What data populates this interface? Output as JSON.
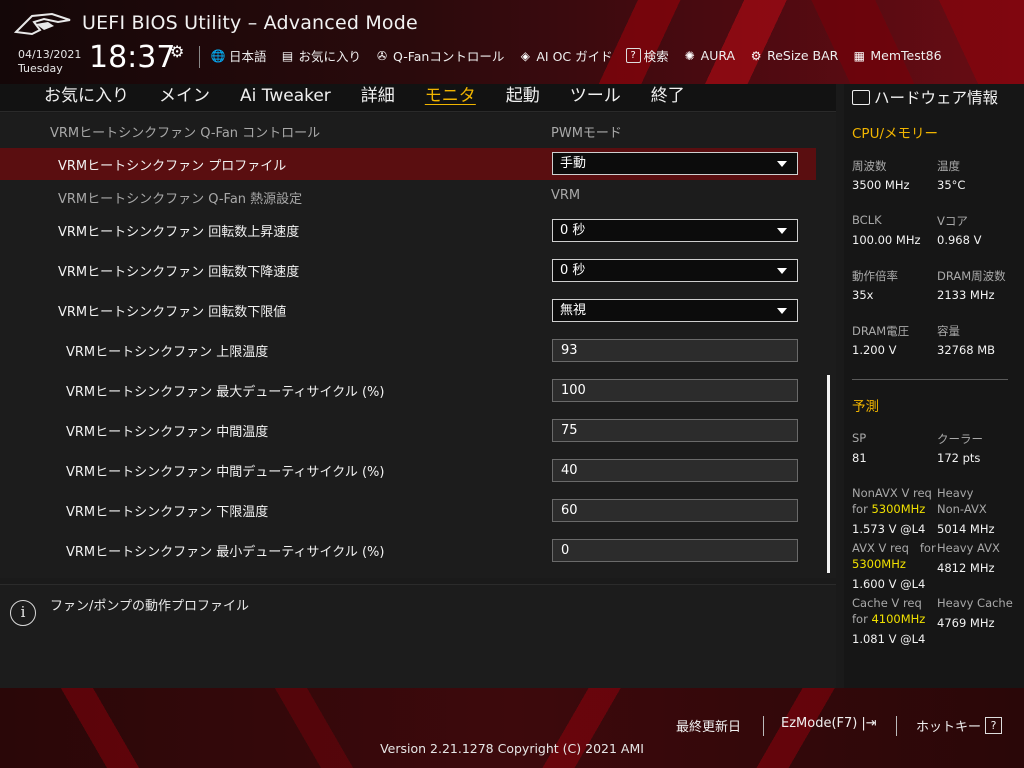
{
  "header": {
    "title": "UEFI BIOS Utility – Advanced Mode",
    "date": "04/13/2021",
    "weekday": "Tuesday",
    "time": "18:37",
    "toolbar": [
      {
        "icon": "globe-icon",
        "glyph": "🌐",
        "label": "日本語"
      },
      {
        "icon": "favorite-icon",
        "glyph": "▤",
        "label": "お気に入り"
      },
      {
        "icon": "fan-icon",
        "glyph": "✇",
        "label": "Q-Fanコントロール"
      },
      {
        "icon": "ai-oc-icon",
        "glyph": "◈",
        "label": "AI OC ガイド"
      },
      {
        "icon": "help-icon",
        "glyph": "?",
        "label": "検索"
      },
      {
        "icon": "aura-icon",
        "glyph": "✺",
        "label": "AURA"
      },
      {
        "icon": "resize-bar-icon",
        "glyph": "⚙",
        "label": "ReSize BAR"
      },
      {
        "icon": "memtest-icon",
        "glyph": "▦",
        "label": "MemTest86"
      }
    ]
  },
  "menu": [
    "お気に入り",
    "メイン",
    "Ai Tweaker",
    "詳細",
    "モニタ",
    "起動",
    "ツール",
    "終了"
  ],
  "menu_active": "モニタ",
  "settings": {
    "section_title": "VRMヒートシンクファン Q-Fan コントロール",
    "section_value": "PWMモード",
    "profile_label": "VRMヒートシンクファン プロファイル",
    "profile_value": "手動",
    "source_label": "VRMヒートシンクファン Q-Fan 熱源設定",
    "source_value": "VRM",
    "step_up_label": "VRMヒートシンクファン 回転数上昇速度",
    "step_up_value": "0 秒",
    "step_down_label": "VRMヒートシンクファン 回転数下降速度",
    "step_down_value": "0 秒",
    "lower_limit_label": "VRMヒートシンクファン 回転数下限値",
    "lower_limit_value": "無視",
    "upper_temp_label": "VRMヒートシンクファン 上限温度",
    "upper_temp_value": "93",
    "max_duty_label": "VRMヒートシンクファン 最大デューティサイクル (%)",
    "max_duty_value": "100",
    "middle_temp_label": "VRMヒートシンクファン 中間温度",
    "middle_temp_value": "75",
    "middle_duty_label": "VRMヒートシンクファン 中間デューティサイクル (%)",
    "middle_duty_value": "40",
    "lower_temp_label": "VRMヒートシンクファン 下限温度",
    "lower_temp_value": "60",
    "min_duty_label": "VRMヒートシンクファン 最小デューティサイクル (%)",
    "min_duty_value": "0"
  },
  "help": {
    "text": "ファン/ポンプの動作プロファイル"
  },
  "hardware": {
    "title": "ハードウェア情報",
    "cpu_section": "CPU/メモリー",
    "freq_label": "周波数",
    "freq_value": "3500 MHz",
    "temp_label": "温度",
    "temp_value": "35°C",
    "bclk_label": "BCLK",
    "bclk_value": "100.00 MHz",
    "vcore_label": "Vコア",
    "vcore_value": "0.968 V",
    "ratio_label": "動作倍率",
    "ratio_value": "35x",
    "dram_freq_label": "DRAM周波数",
    "dram_freq_value": "2133 MHz",
    "dram_volt_label": "DRAM電圧",
    "dram_volt_value": "1.200 V",
    "capacity_label": "容量",
    "capacity_value": "32768 MB",
    "predict_section": "予測",
    "sp_label": "SP",
    "sp_value": "81",
    "cooler_label": "クーラー",
    "cooler_value": "172 pts",
    "nonavx_label": "NonAVX V req",
    "nonavx_for": "for",
    "nonavx_freq": "5300MHz",
    "nonavx_value": "1.573 V @L4",
    "heavy_nonavx_label1": "Heavy",
    "heavy_nonavx_label2": "Non-AVX",
    "heavy_nonavx_value": "5014 MHz",
    "avx_label": "AVX V req",
    "avx_for": "for",
    "avx_freq": "5300MHz",
    "avx_value": "1.600 V @L4",
    "heavy_avx_label": "Heavy AVX",
    "heavy_avx_value": "4812 MHz",
    "cache_label": "Cache V req",
    "cache_for": "for",
    "cache_freq": "4100MHz",
    "cache_value": "1.081 V @L4",
    "heavy_cache_label": "Heavy Cache",
    "heavy_cache_value": "4769 MHz"
  },
  "footer": {
    "last_modified": "最終更新日",
    "ezmode": "EzMode(F7)",
    "hotkeys": "ホットキー",
    "version": "Version 2.21.1278 Copyright (C) 2021 AMI"
  },
  "colors": {
    "accent": "#f0b400",
    "selected_row": "#5a0e10",
    "highlight": "#f0e000"
  }
}
